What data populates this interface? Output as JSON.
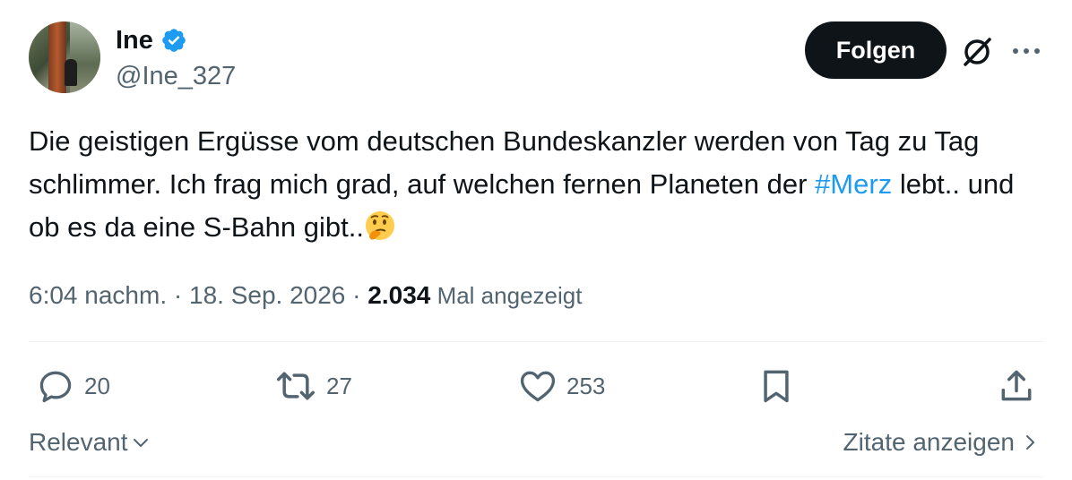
{
  "author": {
    "display_name": "Ine",
    "handle": "@Ine_327",
    "verified": true
  },
  "header": {
    "follow_label": "Folgen"
  },
  "tweet": {
    "text_part1": "Die geistigen Ergüsse vom deutschen Bundeskanzler werden von Tag zu Tag schlimmer. Ich frag mich grad, auf welchen fernen Planeten der ",
    "hashtag": "#Merz",
    "text_part2": " lebt.. und ob es da eine S-Bahn gibt..",
    "emoji": "thinking-face-emoji"
  },
  "meta": {
    "time": "6:04 nachm.",
    "separator1": " · ",
    "date": "18. Sep. 2026",
    "separator2": " · ",
    "views_count": "2.034",
    "views_label": " Mal angezeigt"
  },
  "actions": {
    "replies": "20",
    "retweets": "27",
    "likes": "253"
  },
  "footer": {
    "sort_label": "Relevant",
    "quotes_label": "Zitate anzeigen"
  },
  "colors": {
    "accent": "#1d9bf0",
    "text_primary": "#0f1419",
    "text_secondary": "#536471",
    "button_bg": "#0f1419"
  }
}
